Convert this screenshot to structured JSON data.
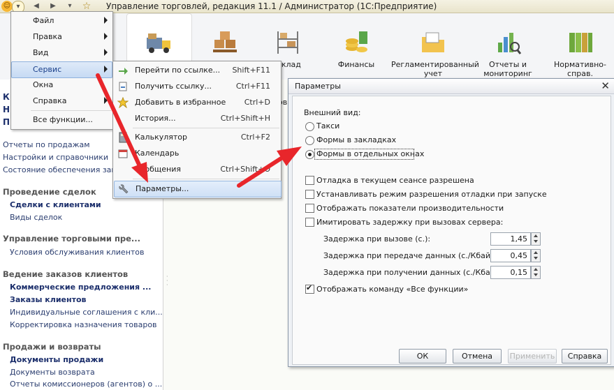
{
  "window": {
    "title": "Управление торговлей, редакция 11.1 / Администратор  (1С:Предприятие)"
  },
  "ribbon": {
    "sections": [
      {
        "label": ""
      },
      {
        "label": ""
      },
      {
        "label": "Склад"
      },
      {
        "label": "Финансы"
      },
      {
        "label": "Регламентированный учет"
      },
      {
        "label": "Отчеты и мониторинг"
      },
      {
        "label": "Нормативно-справ. информация"
      }
    ]
  },
  "main_menu": {
    "items": [
      {
        "label": "Файл",
        "submenu": true
      },
      {
        "label": "Правка",
        "submenu": true
      },
      {
        "label": "Вид",
        "submenu": true
      },
      {
        "label": "Сервис",
        "submenu": true
      },
      {
        "label": "Окна",
        "submenu": false
      },
      {
        "label": "Справка",
        "submenu": true
      },
      {
        "label": "Все функции...",
        "submenu": false
      }
    ]
  },
  "service_menu": {
    "items": [
      {
        "label": "Перейти по ссылке...",
        "shortcut": "Shift+F11"
      },
      {
        "label": "Получить ссылку...",
        "shortcut": "Ctrl+F11"
      },
      {
        "label": "Добавить в избранное",
        "shortcut": "Ctrl+D"
      },
      {
        "label": "История...",
        "shortcut": "Ctrl+Shift+H"
      },
      {
        "label": "Калькулятор",
        "shortcut": "Ctrl+F2"
      },
      {
        "label": "Календарь",
        "shortcut": ""
      },
      {
        "label": "Сообщения",
        "shortcut": "Ctrl+Shift+O"
      },
      {
        "label": "Параметры...",
        "shortcut": ""
      }
    ]
  },
  "left_nav": {
    "top_letters": [
      "К",
      "Н",
      "П"
    ],
    "quick_links": [
      "Отчеты по продажам",
      "Настройки и справочники",
      "Состояние обеспечения заказов"
    ],
    "groups": [
      {
        "title": "Проведение сделок",
        "items": [
          {
            "label": "Сделки с клиентами",
            "bold": true
          },
          {
            "label": "Виды сделок",
            "bold": false
          }
        ]
      },
      {
        "title": "Управление торговыми пре...",
        "items": [
          {
            "label": "Условия обслуживания клиентов",
            "bold": false
          }
        ]
      },
      {
        "title": "Ведение заказов клиентов",
        "items": [
          {
            "label": "Коммерческие предложения ...",
            "bold": true
          },
          {
            "label": "Заказы клиентов",
            "bold": true
          },
          {
            "label": "Индивидуальные соглашения с кли...",
            "bold": false
          },
          {
            "label": "Корректировка назначения товаров",
            "bold": false
          }
        ]
      },
      {
        "title": "Продажи и возвраты",
        "items": [
          {
            "label": "Документы продажи",
            "bold": true
          },
          {
            "label": "Документы возврата",
            "bold": false
          },
          {
            "label": "Отчеты комиссионеров (агентов) о ...",
            "bold": false
          }
        ]
      }
    ]
  },
  "work_area": {
    "partial_text": "ов"
  },
  "dialog": {
    "title": "Параметры",
    "appearance_label": "Внешний вид:",
    "radio_options": [
      "Такси",
      "Формы в закладках",
      "Формы в отдельных окнах"
    ],
    "selected_option": "Формы в отдельных окнах",
    "checkboxes": [
      {
        "label": "Отладка в текущем сеансе разрешена",
        "checked": false
      },
      {
        "label": "Устанавливать режим разрешения отладки при запуске",
        "checked": false
      },
      {
        "label": "Отображать показатели производительности",
        "checked": false
      },
      {
        "label": "Имитировать задержку при вызовах сервера:",
        "checked": false
      }
    ],
    "delays": [
      {
        "label": "Задержка при вызове (с.):",
        "value": "1,45"
      },
      {
        "label": "Задержка при передаче данных (с./Кбайт):",
        "value": "0,45"
      },
      {
        "label": "Задержка при получении данных (с./Кбайт):",
        "value": "0,15"
      }
    ],
    "all_functions": {
      "label": "Отображать команду «Все функции»",
      "checked": true
    },
    "buttons": {
      "ok": "ОК",
      "cancel": "Отмена",
      "apply": "Применить",
      "help": "Справка"
    }
  },
  "colors": {
    "arrow": "#e8262b",
    "menu_highlight": "#cfe0f6",
    "nav_bold": "#1b2e6b"
  }
}
